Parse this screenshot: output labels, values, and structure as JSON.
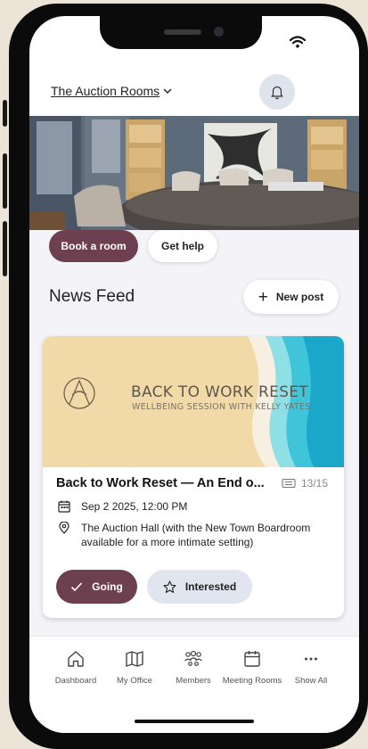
{
  "header": {
    "office_name": "The Auction Rooms"
  },
  "actions": {
    "book_label": "Book a room",
    "help_label": "Get help"
  },
  "newsfeed": {
    "title": "News Feed",
    "new_post_label": "New post"
  },
  "event_card": {
    "banner_title": "BACK TO WORK RESET",
    "banner_subtitle": "WELLBEING SESSION WITH KELLY YATES",
    "title": "Back to Work Reset —  An End o...",
    "count": "13/15",
    "date": "Sep 2 2025, 12:00 PM",
    "location": "The Auction Hall (with the New Town Boardroom available for a more intimate setting)",
    "going_label": "Going",
    "interested_label": "Interested"
  },
  "tabs": [
    {
      "label": "Dashboard",
      "icon": "home-icon"
    },
    {
      "label": "My Office",
      "icon": "map-icon"
    },
    {
      "label": "Members",
      "icon": "members-icon"
    },
    {
      "label": "Meeting Rooms",
      "icon": "calendar-icon"
    },
    {
      "label": "Show All",
      "icon": "more-icon"
    }
  ],
  "colors": {
    "accent": "#6e3f4e",
    "secondary_button": "#e0e5ef",
    "feed_background": "#f4f4f8"
  }
}
